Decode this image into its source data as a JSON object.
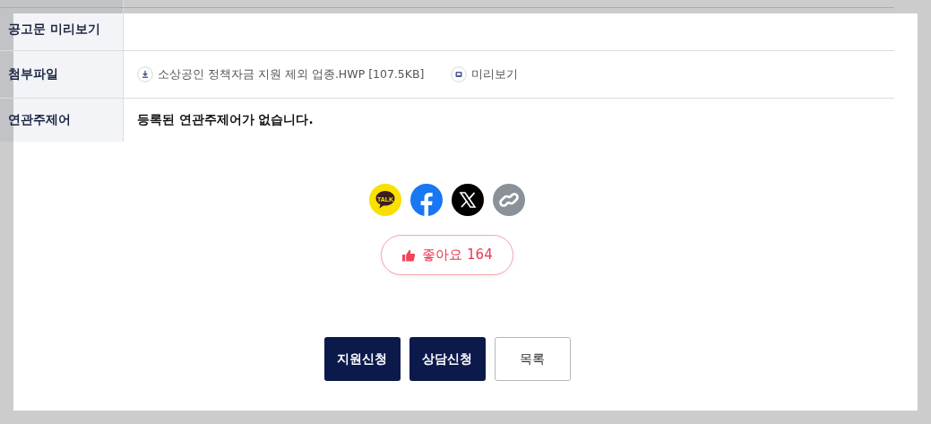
{
  "detail_table": {
    "rows": [
      {
        "label": "공고문 미리보기",
        "kind": "empty"
      },
      {
        "label": "첨부파일",
        "kind": "attachment",
        "file": "소상공인 정책자금 지원 제외 업종.HWP [107.5KB]",
        "preview": "미리보기"
      },
      {
        "label": "연관주제어",
        "kind": "text",
        "value": "등록된 연관주제어가 없습니다."
      }
    ]
  },
  "share": [
    {
      "kind": "kakao",
      "label": "TALK"
    },
    {
      "kind": "facebook"
    },
    {
      "kind": "x"
    },
    {
      "kind": "link"
    }
  ],
  "like": {
    "label": "좋아요",
    "count": "164"
  },
  "buttons": [
    {
      "label": "지원신청",
      "kind": "primary"
    },
    {
      "label": "상담신청",
      "kind": "primary"
    },
    {
      "label": "목록",
      "kind": "outline"
    }
  ]
}
